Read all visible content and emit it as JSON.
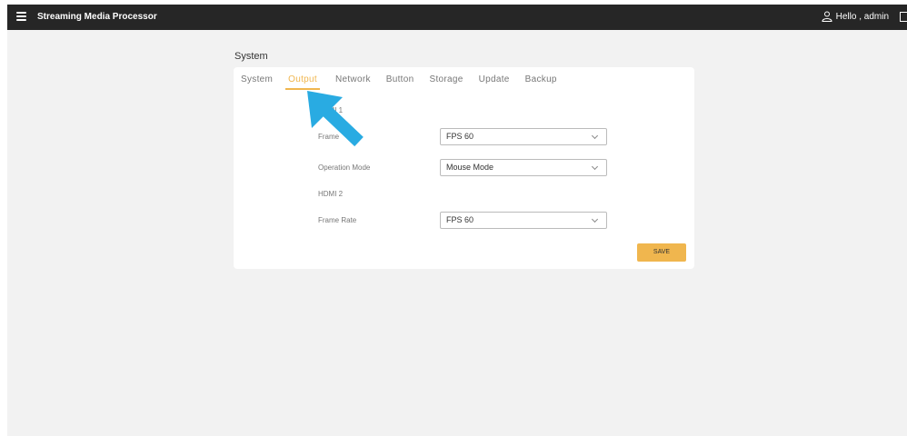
{
  "topbar": {
    "title": "Streaming Media Processor",
    "user_greeting": "Hello , admin"
  },
  "page": {
    "section_title": "System"
  },
  "tabs": [
    {
      "label": "System",
      "active": false
    },
    {
      "label": "Output",
      "active": true
    },
    {
      "label": "Network",
      "active": false
    },
    {
      "label": "Button",
      "active": false
    },
    {
      "label": "Storage",
      "active": false
    },
    {
      "label": "Update",
      "active": false
    },
    {
      "label": "Backup",
      "active": false
    }
  ],
  "form": {
    "hdmi1_label": "HDMI 1",
    "frame_rate_1_label": "Frame",
    "frame_rate_1_value": "FPS 60",
    "operation_mode_label": "Operation Mode",
    "operation_mode_value": "Mouse Mode",
    "hdmi2_label": "HDMI 2",
    "frame_rate_2_label": "Frame Rate",
    "frame_rate_2_value": "FPS 60",
    "save_label": "SAVE"
  },
  "colors": {
    "accent": "#f0b64e",
    "topbar": "#262626",
    "annotation_arrow": "#29abe2"
  }
}
